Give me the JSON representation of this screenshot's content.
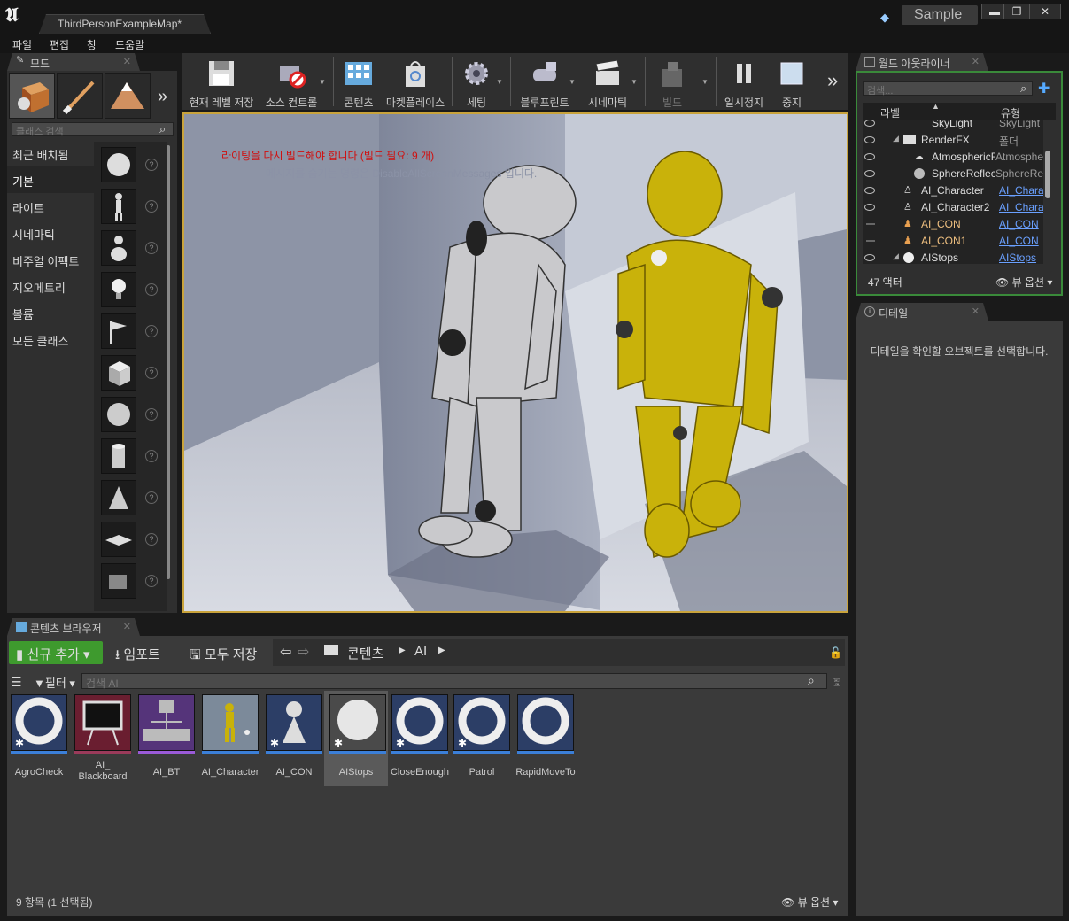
{
  "window": {
    "tab_title": "ThirdPersonExampleMap*",
    "project": "Sample",
    "controls": [
      "▬",
      "❐",
      "✕"
    ]
  },
  "menu": [
    "파일",
    "편집",
    "창",
    "도움말"
  ],
  "modes": {
    "tab_label": "모드",
    "search_placeholder": "클래스 검색",
    "categories": [
      "최근 배치됨",
      "기본",
      "라이트",
      "시네마틱",
      "비주얼 이펙트",
      "지오메트리",
      "볼륨",
      "모든 클래스"
    ],
    "selected_category": "기본",
    "help_glyph": "?"
  },
  "toolbar": {
    "buttons": [
      "현재 레벨 저장",
      "소스 컨트롤",
      "콘텐츠",
      "마켓플레이스",
      "세팅",
      "블루프린트",
      "시네마틱",
      "빌드",
      "일시정지",
      "중지"
    ]
  },
  "viewport": {
    "warning": "라이팅을 다시 빌드해야 합니다 (빌드 필요: 9 개)",
    "hint": "메시지를 숨기는 명령은 DisableAllScreenMessages 입니다."
  },
  "outliner": {
    "tab_label": "월드 아웃라이너",
    "search_placeholder": "검색...",
    "col_label": "라벨",
    "col_type": "유형",
    "rows": [
      {
        "label": "SkyLight",
        "type": "SkyLight",
        "link": false
      },
      {
        "label": "RenderFX",
        "type": "폴더",
        "link": false
      },
      {
        "label": "AtmosphericF",
        "type": "Atmosphe",
        "link": false
      },
      {
        "label": "SphereReflect",
        "type": "SphereRef",
        "link": false
      },
      {
        "label": "AI_Character",
        "type": "AI_Chara",
        "link": true
      },
      {
        "label": "AI_Character2",
        "type": "AI_Chara",
        "link": true
      },
      {
        "label": "AI_CON",
        "type": "AI_CON",
        "link": true
      },
      {
        "label": "AI_CON1",
        "type": "AI_CON",
        "link": true
      },
      {
        "label": "AIStops",
        "type": "AIStops",
        "link": true
      }
    ],
    "count": "47 액터",
    "view_options": "뷰 옵션"
  },
  "details": {
    "tab_label": "디테일",
    "empty_message": "디테일을 확인할 오브젝트를 선택합니다."
  },
  "content_browser": {
    "tab_label": "콘텐츠 브라우저",
    "add_new": "신규 추가",
    "import": "임포트",
    "save_all": "모두 저장",
    "path": [
      "콘텐츠",
      "AI"
    ],
    "filter": "필터",
    "search_placeholder": "검색 AI",
    "assets": [
      "AgroCheck",
      "AI_\nBlackboard",
      "AI_BT",
      "AI_Character",
      "AI_CON",
      "AIStops",
      "CloseEnough",
      "Patrol",
      "RapidMoveTo"
    ],
    "selected_asset": "AIStops",
    "status": "9 항목 (1 선택됨)",
    "view_options": "뷰 옵션"
  },
  "colors": {
    "add_new": "#3e9a2e",
    "viewport_border": "#c9a33b",
    "warning": "#d01010",
    "link": "#6aa0ff",
    "outliner_border": "#3a8a3a"
  }
}
